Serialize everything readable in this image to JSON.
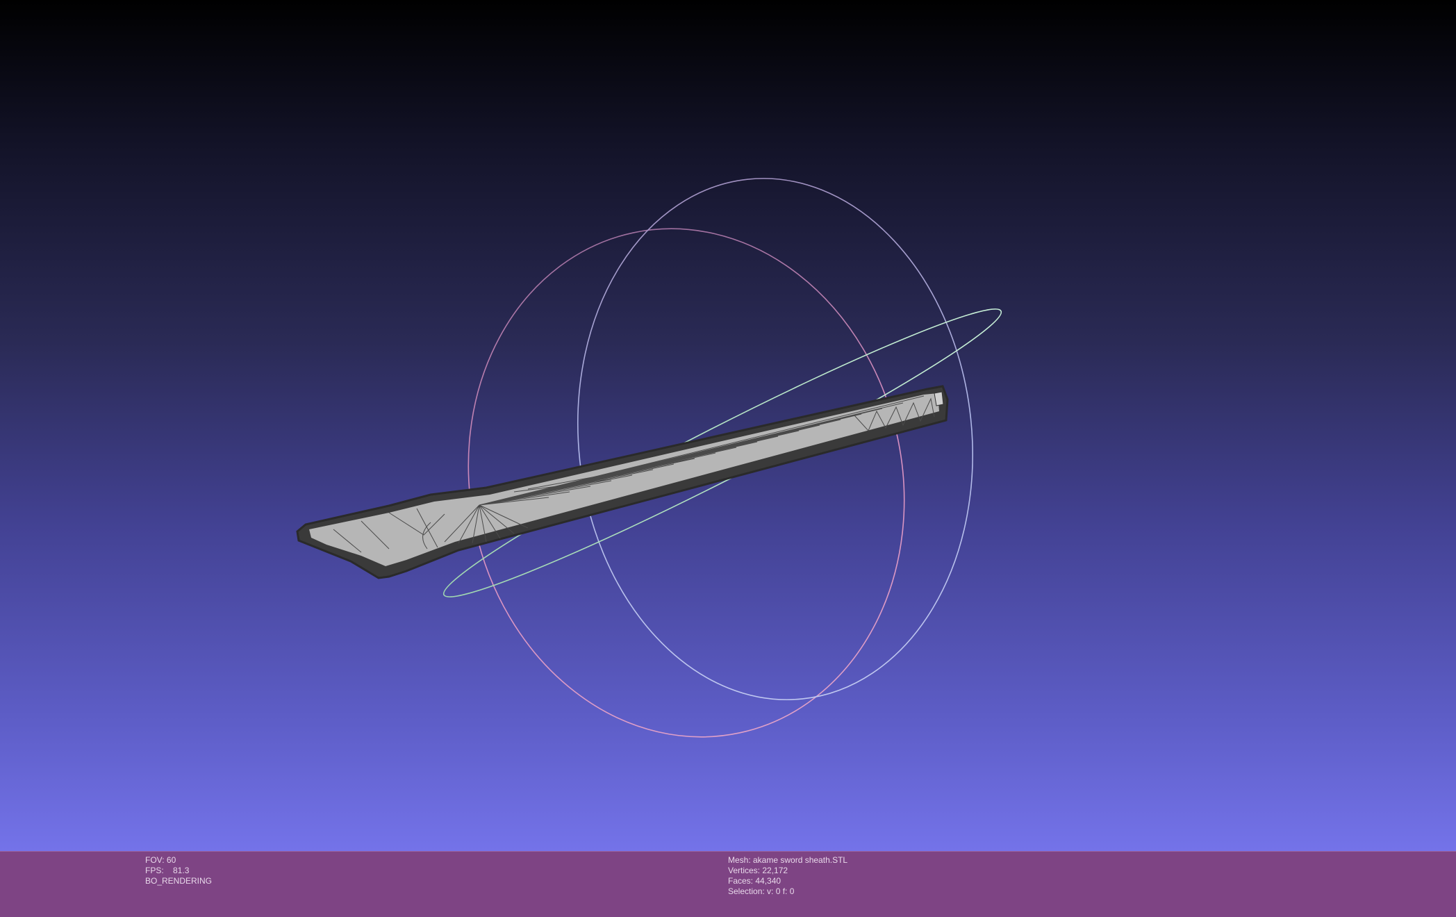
{
  "window": {
    "title": ""
  },
  "viewport": {
    "background_top": "#000000",
    "background_bottom": "#7473e9",
    "trackball_colors": {
      "x_ring": "#e090c0",
      "y_ring": "#a0c8f0",
      "z_ring": "#b8f0c8"
    },
    "mesh_color": "#b4b4b4",
    "wire_color": "#3a3a3a"
  },
  "info_bar": {
    "background": "#7e4484",
    "left": {
      "fov": "FOV: 60",
      "fps": "FPS:    81.3",
      "render_mode": "BO_RENDERING"
    },
    "right": {
      "mesh": "Mesh: akame sword sheath.STL",
      "vertices": "Vertices: 22,172",
      "faces": "Faces: 44,340",
      "selection": "Selection: v: 0 f: 0"
    }
  }
}
